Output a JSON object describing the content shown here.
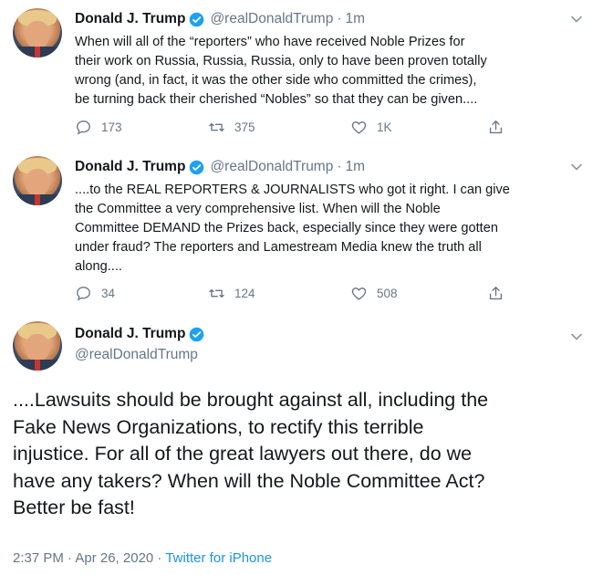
{
  "tweets": [
    {
      "name": "Donald J. Trump",
      "handle": "@realDonaldTrump",
      "separator": "·",
      "time": "1m",
      "text_lines": [
        "When will all of the “reporters” who have received Noble Prizes for",
        "their work on Russia, Russia, Russia, only to have been proven totally",
        "wrong (and, in fact, it was the other side who committed the crimes),",
        "be turning back their cherished “Nobles” so that they can be given...."
      ],
      "replies": "173",
      "retweets": "375",
      "likes": "1K"
    },
    {
      "name": "Donald J. Trump",
      "handle": "@realDonaldTrump",
      "separator": "·",
      "time": "1m",
      "text_lines": [
        "....to the REAL REPORTERS & JOURNALISTS who got it right. I can give",
        "the Committee a very comprehensive list. When will the Noble",
        "Committee DEMAND the Prizes back, especially since they were gotten",
        "under fraud? The reporters and Lamestream Media knew the truth all",
        "along...."
      ],
      "replies": "34",
      "retweets": "124",
      "likes": "508"
    }
  ],
  "main_tweet": {
    "name": "Donald J. Trump",
    "handle": "@realDonaldTrump",
    "text_lines": [
      "....Lawsuits should be brought against all, including the",
      "Fake News Organizations, to rectify this terrible",
      "injustice. For all of the great lawyers out there, do we",
      "have any takers? When will the Noble Committee Act?",
      "Better be fast!"
    ],
    "timestamp": "2:37 PM · Apr 26, 2020 ·",
    "source": "Twitter for iPhone"
  },
  "icons": {
    "verified": "verified-badge-icon",
    "reply": "reply-icon",
    "retweet": "retweet-icon",
    "like": "heart-icon",
    "share": "share-icon",
    "caret": "chevron-down-icon"
  },
  "colors": {
    "text": "#14171a",
    "secondary": "#657786",
    "link": "#1b95e0",
    "verified": "#1da1f2"
  }
}
